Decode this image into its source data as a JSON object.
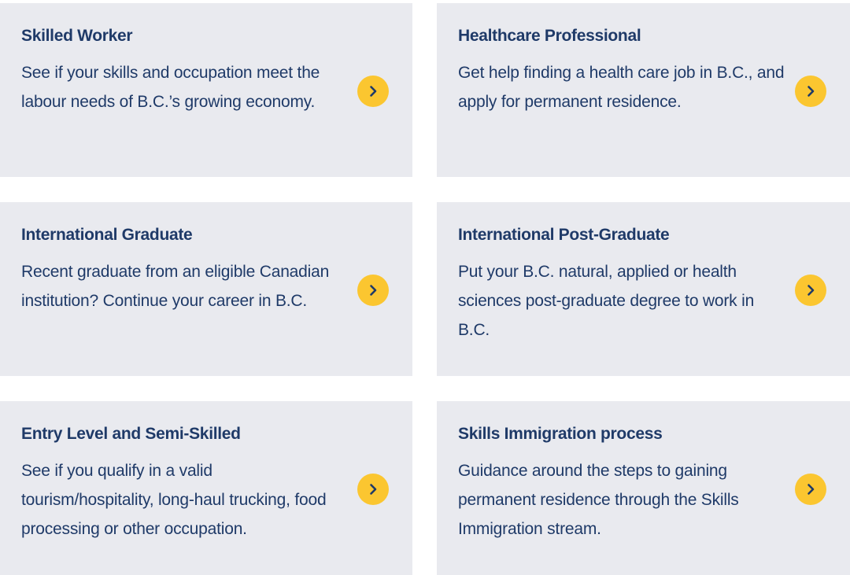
{
  "cards": [
    {
      "title": "Skilled Worker",
      "description": "See if your skills and occupation meet the labour needs of B.C.’s growing economy.",
      "icon": "chevron-right-icon"
    },
    {
      "title": "Healthcare Professional",
      "description": "Get help finding a health care job in B.C., and apply for permanent residence.",
      "icon": "chevron-right-icon"
    },
    {
      "title": "International Graduate",
      "description": "Recent graduate from an eligible Canadian institution? Continue your career in B.C.",
      "icon": "chevron-right-icon"
    },
    {
      "title": "International Post-Graduate",
      "description": "Put your B.C. natural, applied or health sciences post-graduate degree to work in B.C.",
      "icon": "chevron-right-icon"
    },
    {
      "title": "Entry Level and Semi-Skilled",
      "description": "See if you qualify in a valid tourism/hospitality, long-haul trucking, food processing or other occupation.",
      "icon": "chevron-right-icon"
    },
    {
      "title": "Skills Immigration process",
      "description": "Guidance around the steps to gaining permanent residence through the Skills Immigration stream.",
      "icon": "chevron-right-icon"
    }
  ],
  "colors": {
    "card_background": "#e9eaef",
    "text": "#1f3a68",
    "arrow_button": "#fbc630"
  }
}
